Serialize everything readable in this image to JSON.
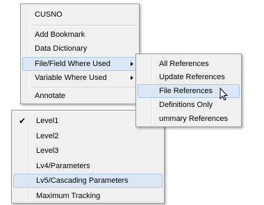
{
  "context_menu": {
    "items": [
      {
        "label": "CUSNO"
      },
      {
        "label": "Add Bookmark"
      },
      {
        "label": "Data Dictionary"
      },
      {
        "label": "File/Field Where Used",
        "submenu": true,
        "highlighted": true
      },
      {
        "label": "Variable Where Used",
        "submenu": true
      },
      {
        "label": "Annotate"
      }
    ]
  },
  "submenu": {
    "items": [
      {
        "label": "All References"
      },
      {
        "label": "Update References"
      },
      {
        "label": "File References",
        "highlighted": true
      },
      {
        "label": "Definitions Only"
      },
      {
        "label": "Summary References",
        "visible_text": "ummary References"
      }
    ]
  },
  "level_menu": {
    "items": [
      {
        "label": "Level1",
        "checked": true
      },
      {
        "label": "Level2"
      },
      {
        "label": "Level3"
      },
      {
        "label": "Lv4/Parameters"
      },
      {
        "label": "Lv5/Cascading Parameters",
        "highlighted": true
      },
      {
        "label": "Maximum Tracking"
      }
    ]
  },
  "icons": {
    "checkmark": "checkmark-icon",
    "submenu_arrow": "submenu-arrow-icon",
    "cursor": "mouse-pointer-icon"
  },
  "colors": {
    "menu_background": "#f0f0f0",
    "highlight": "#dce7f5",
    "highlight_border": "#a8c8ee"
  }
}
